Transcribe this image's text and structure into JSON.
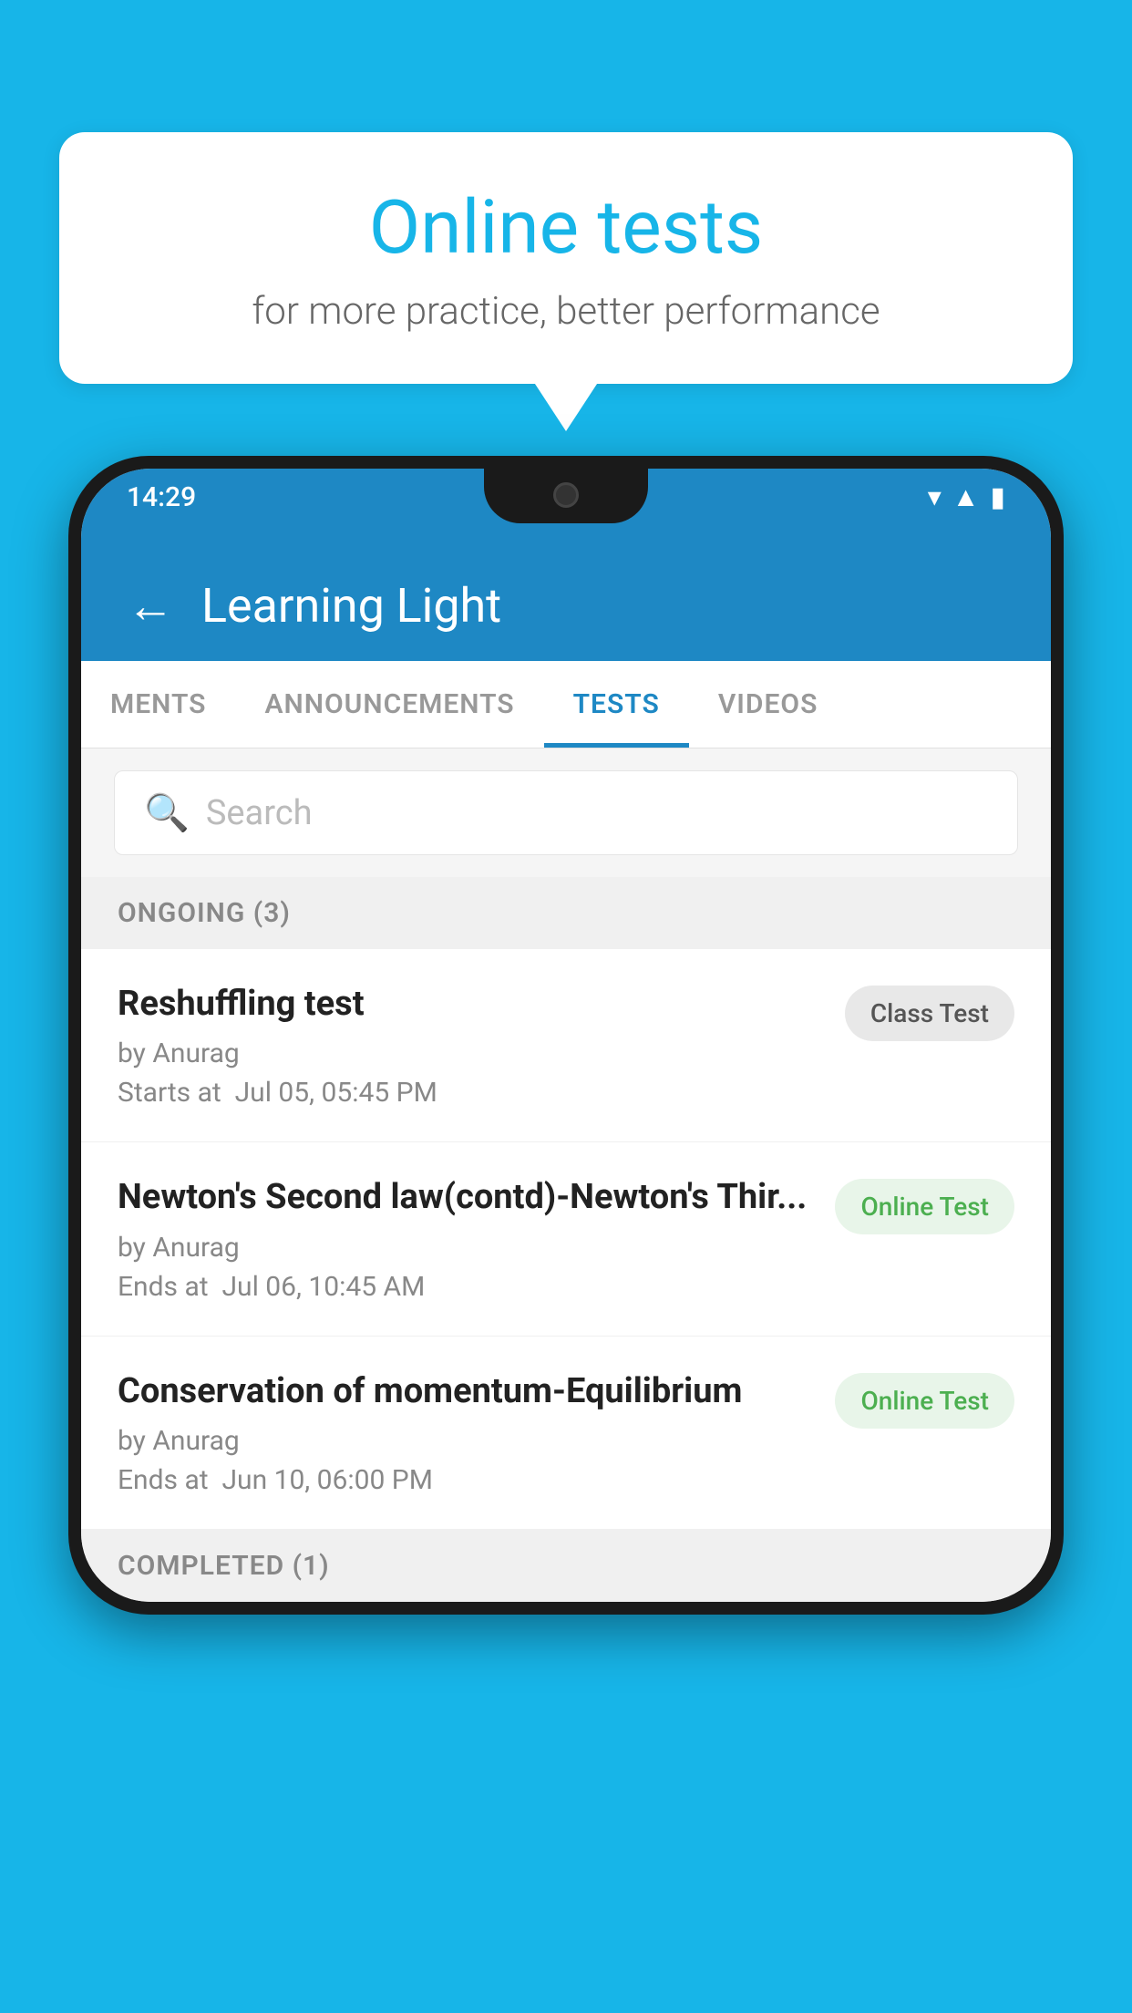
{
  "background": {
    "color": "#17b5e8"
  },
  "speechBubble": {
    "title": "Online tests",
    "subtitle": "for more practice, better performance"
  },
  "statusBar": {
    "time": "14:29",
    "icons": [
      "wifi",
      "signal",
      "battery"
    ]
  },
  "appHeader": {
    "title": "Learning Light",
    "backLabel": "←"
  },
  "tabs": [
    {
      "label": "MENTS",
      "active": false
    },
    {
      "label": "ANNOUNCEMENTS",
      "active": false
    },
    {
      "label": "TESTS",
      "active": true
    },
    {
      "label": "VIDEOS",
      "active": false
    }
  ],
  "search": {
    "placeholder": "Search"
  },
  "ongoingSection": {
    "label": "ONGOING (3)"
  },
  "tests": [
    {
      "name": "Reshuffling test",
      "author": "by Anurag",
      "timeLabel": "Starts at",
      "time": "Jul 05, 05:45 PM",
      "badgeText": "Class Test",
      "badgeType": "class"
    },
    {
      "name": "Newton's Second law(contd)-Newton's Thir...",
      "author": "by Anurag",
      "timeLabel": "Ends at",
      "time": "Jul 06, 10:45 AM",
      "badgeText": "Online Test",
      "badgeType": "online"
    },
    {
      "name": "Conservation of momentum-Equilibrium",
      "author": "by Anurag",
      "timeLabel": "Ends at",
      "time": "Jun 10, 06:00 PM",
      "badgeText": "Online Test",
      "badgeType": "online"
    }
  ],
  "completedSection": {
    "label": "COMPLETED (1)"
  }
}
